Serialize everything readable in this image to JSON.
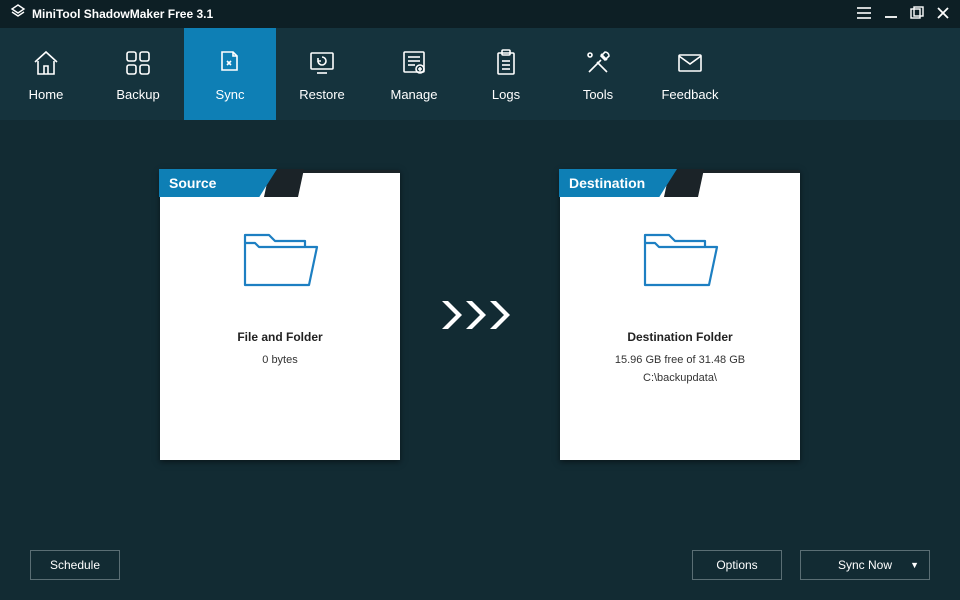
{
  "titlebar": {
    "title": "MiniTool ShadowMaker Free 3.1"
  },
  "nav": {
    "items": [
      {
        "label": "Home"
      },
      {
        "label": "Backup"
      },
      {
        "label": "Sync"
      },
      {
        "label": "Restore"
      },
      {
        "label": "Manage"
      },
      {
        "label": "Logs"
      },
      {
        "label": "Tools"
      },
      {
        "label": "Feedback"
      }
    ]
  },
  "source": {
    "header": "Source",
    "caption": "File and Folder",
    "size": "0 bytes"
  },
  "destination": {
    "header": "Destination",
    "caption": "Destination Folder",
    "space": "15.96 GB free of 31.48 GB",
    "path": "C:\\backupdata\\"
  },
  "buttons": {
    "schedule": "Schedule",
    "options": "Options",
    "sync_now": "Sync Now"
  }
}
